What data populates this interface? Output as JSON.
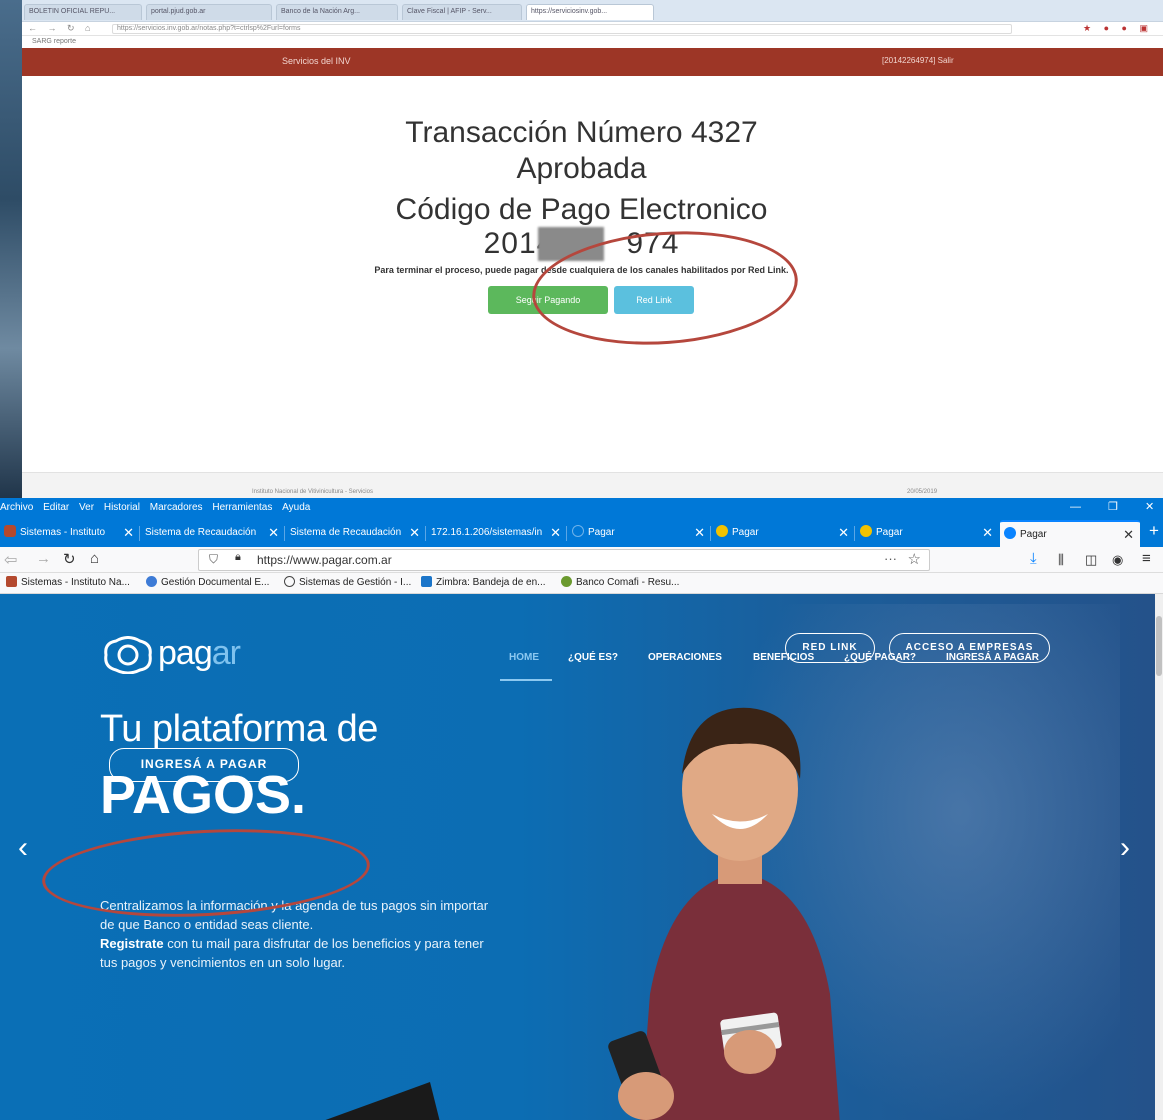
{
  "top": {
    "tabs": [
      "BOLETIN OFICIAL REPU...",
      "portal.pjud.gob.ar",
      "Banco de la Nación Arg...",
      "Clave Fiscal | AFIP - Serv...",
      "https://serviciosinv.gob..."
    ],
    "url": "https://servicios.inv.gob.ar/notas.php?t=ctrlsp%2Furl=forms",
    "bookmark": "SARG reporte",
    "header_service": "Servicios del INV",
    "header_user": "[20142264974] Salir",
    "title_line1": "Transacción Número 4327",
    "title_line2": "Aprobada",
    "code_line1": "Código de Pago Electronico",
    "code_prefix": "2014",
    "code_suffix": "974",
    "instruction": "Para terminar el proceso, puede pagar desde cualquiera de los canales habilitados por Red Link.",
    "btn_seguir": "Seguir Pagando",
    "btn_redlink": "Red Link",
    "footer_text": "Instituto Nacional de Vitivinicultura - Servicios",
    "footer_date": "20/05/2019"
  },
  "menubar": [
    "Archivo",
    "Editar",
    "Ver",
    "Historial",
    "Marcadores",
    "Herramientas",
    "Ayuda"
  ],
  "tabs": [
    {
      "label": "Sistemas - Instituto",
      "icon_color": "#b4492e",
      "icon": "inv-icon"
    },
    {
      "label": "Sistema de Recaudación",
      "icon_color": "",
      "icon": ""
    },
    {
      "label": "Sistema de Recaudación",
      "icon_color": "",
      "icon": ""
    },
    {
      "label": "172.16.1.206/sistemas/in",
      "icon_color": "",
      "icon": ""
    },
    {
      "label": "Pagar",
      "icon_color": "#6fb3ea",
      "icon": "pagar-icon"
    },
    {
      "label": "Pagar",
      "icon_color": "#f2c200",
      "icon": "link-icon"
    },
    {
      "label": "Pagar",
      "icon_color": "#f2c200",
      "icon": "link-icon"
    },
    {
      "label": "Pagar",
      "icon_color": "#0a84ff",
      "icon": "pagar-icon"
    }
  ],
  "window_controls": {
    "min": "—",
    "restore": "❐",
    "close": "✕",
    "newtab": "+"
  },
  "navbar": {
    "url": "https://www.pagar.com.ar",
    "dots": "···"
  },
  "bookmarks": [
    {
      "label": "Sistemas - Instituto Na...",
      "color": "#b4492e"
    },
    {
      "label": "Gestión Documental E...",
      "color": "#3d7bd6"
    },
    {
      "label": "Sistemas de Gestión - I...",
      "color": "#444444"
    },
    {
      "label": "Zimbra: Bandeja de en...",
      "color": "#1b75c9"
    },
    {
      "label": "Banco Comafi - Resu...",
      "color": "#6b9a2f"
    }
  ],
  "hero": {
    "btn_redlink": "RED LINK",
    "btn_empresas": "ACCESO A EMPRESAS",
    "logo_main": "pag",
    "logo_accent": "ar",
    "nav": [
      "HOME",
      "¿QUÉ ES?",
      "OPERACIONES",
      "BENEFICIOS",
      "¿QUÉ PAGAR?",
      "INGRESÁ A PAGAR"
    ],
    "title_light": "Tu plataforma de",
    "title_bold": "PAGOS.",
    "desc_1": "Centralizamos la información y la agenda de tus pagos sin importar de que Banco o entidad seas cliente.",
    "desc_bold": "Registrate",
    "desc_2": " con tu mail para disfrutar de los beneficios y para tener tus pagos y vencimientos en un solo lugar.",
    "cta": "INGRESÁ A PAGAR",
    "prev": "‹",
    "next": "›"
  },
  "colors": {
    "brand_blue": "#0c6db3",
    "inv_header": "#9d3626",
    "annotation": "#b5473d",
    "firefox_blue": "#0078d7"
  }
}
